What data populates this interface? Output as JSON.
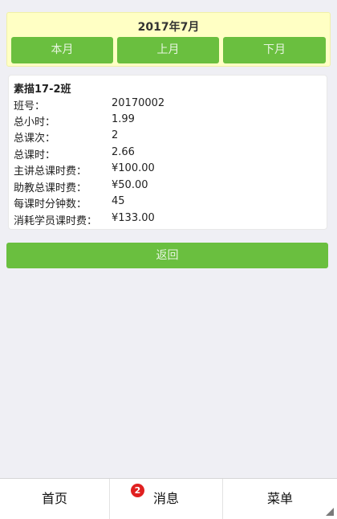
{
  "header": {
    "month_title": "2017年7月",
    "this_month": "本月",
    "prev_month": "上月",
    "next_month": "下月"
  },
  "card": {
    "class_name": "素描17-2班",
    "rows": [
      {
        "label": "班号：",
        "value": "20170002"
      },
      {
        "label": "总小时：",
        "value": "1.99"
      },
      {
        "label": "总课次：",
        "value": "2"
      },
      {
        "label": "总课时：",
        "value": "2.66"
      },
      {
        "label": "主讲总课时费：",
        "value": "¥100.00"
      },
      {
        "label": "助教总课时费：",
        "value": "¥50.00"
      },
      {
        "label": "每课时分钟数：",
        "value": "45"
      },
      {
        "label": "消耗学员课时费：",
        "value": "¥133.00"
      }
    ]
  },
  "back_label": "返回",
  "tabbar": {
    "home": "首页",
    "messages": "消息",
    "messages_badge": "2",
    "menu": "菜单"
  },
  "colors": {
    "accent_green": "#6abf3f",
    "header_bg": "#ffffc4",
    "badge_red": "#e02020"
  }
}
